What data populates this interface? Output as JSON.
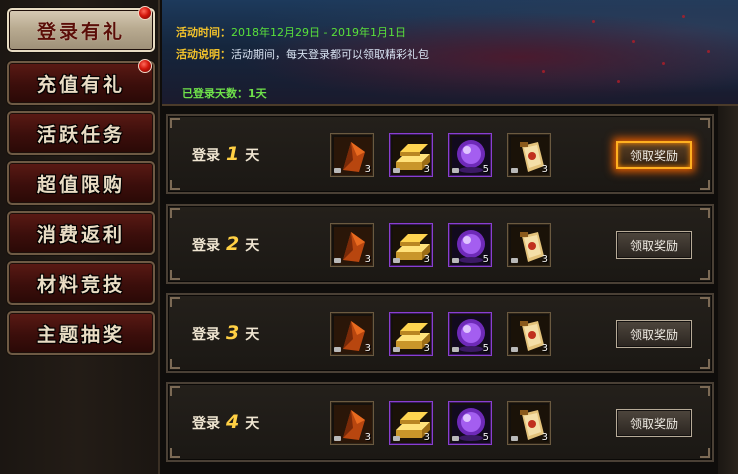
{
  "sidebar": {
    "items": [
      {
        "label": "登录有礼",
        "active": true,
        "badge": true
      },
      {
        "label": "充值有礼",
        "active": false,
        "badge": true
      },
      {
        "label": "活跃任务",
        "active": false,
        "badge": false
      },
      {
        "label": "超值限购",
        "active": false,
        "badge": false
      },
      {
        "label": "消费返利",
        "active": false,
        "badge": false
      },
      {
        "label": "材料竞技",
        "active": false,
        "badge": false
      },
      {
        "label": "主题抽奖",
        "active": false,
        "badge": false
      }
    ]
  },
  "banner": {
    "time_key": "活动时间：",
    "time_start": "2018年12月29日",
    "time_sep": " - ",
    "time_end": "2019年1月1日",
    "desc_key": "活动说明：",
    "desc_value": "活动期间，每天登录都可以领取精彩礼包",
    "days_key": "已登录天数：",
    "days_value": "1天"
  },
  "rows": [
    {
      "prefix": "登录",
      "day": "1",
      "suffix": "天",
      "claim_label": "领取奖励",
      "claimable": true,
      "items": [
        {
          "icon": "orange-shard-icon",
          "qty": "3"
        },
        {
          "icon": "gold-bar-icon",
          "qty": "3"
        },
        {
          "icon": "purple-orb-icon",
          "qty": "5"
        },
        {
          "icon": "scroll-pouch-icon",
          "qty": "3"
        }
      ]
    },
    {
      "prefix": "登录",
      "day": "2",
      "suffix": "天",
      "claim_label": "领取奖励",
      "claimable": false,
      "items": [
        {
          "icon": "orange-shard-icon",
          "qty": "3"
        },
        {
          "icon": "gold-bar-icon",
          "qty": "3"
        },
        {
          "icon": "purple-orb-icon",
          "qty": "5"
        },
        {
          "icon": "scroll-pouch-icon",
          "qty": "3"
        }
      ]
    },
    {
      "prefix": "登录",
      "day": "3",
      "suffix": "天",
      "claim_label": "领取奖励",
      "claimable": false,
      "items": [
        {
          "icon": "orange-shard-icon",
          "qty": "3"
        },
        {
          "icon": "gold-bar-icon",
          "qty": "3"
        },
        {
          "icon": "purple-orb-icon",
          "qty": "5"
        },
        {
          "icon": "scroll-pouch-icon",
          "qty": "3"
        }
      ]
    },
    {
      "prefix": "登录",
      "day": "4",
      "suffix": "天",
      "claim_label": "领取奖励",
      "claimable": false,
      "items": [
        {
          "icon": "orange-shard-icon",
          "qty": "3"
        },
        {
          "icon": "gold-bar-icon",
          "qty": "3"
        },
        {
          "icon": "purple-orb-icon",
          "qty": "5"
        },
        {
          "icon": "scroll-pouch-icon",
          "qty": "3"
        }
      ]
    }
  ],
  "colors": {
    "accent_gold": "#ffd044",
    "highlight_green": "#59e03a",
    "glow_orange": "#ffb020"
  }
}
